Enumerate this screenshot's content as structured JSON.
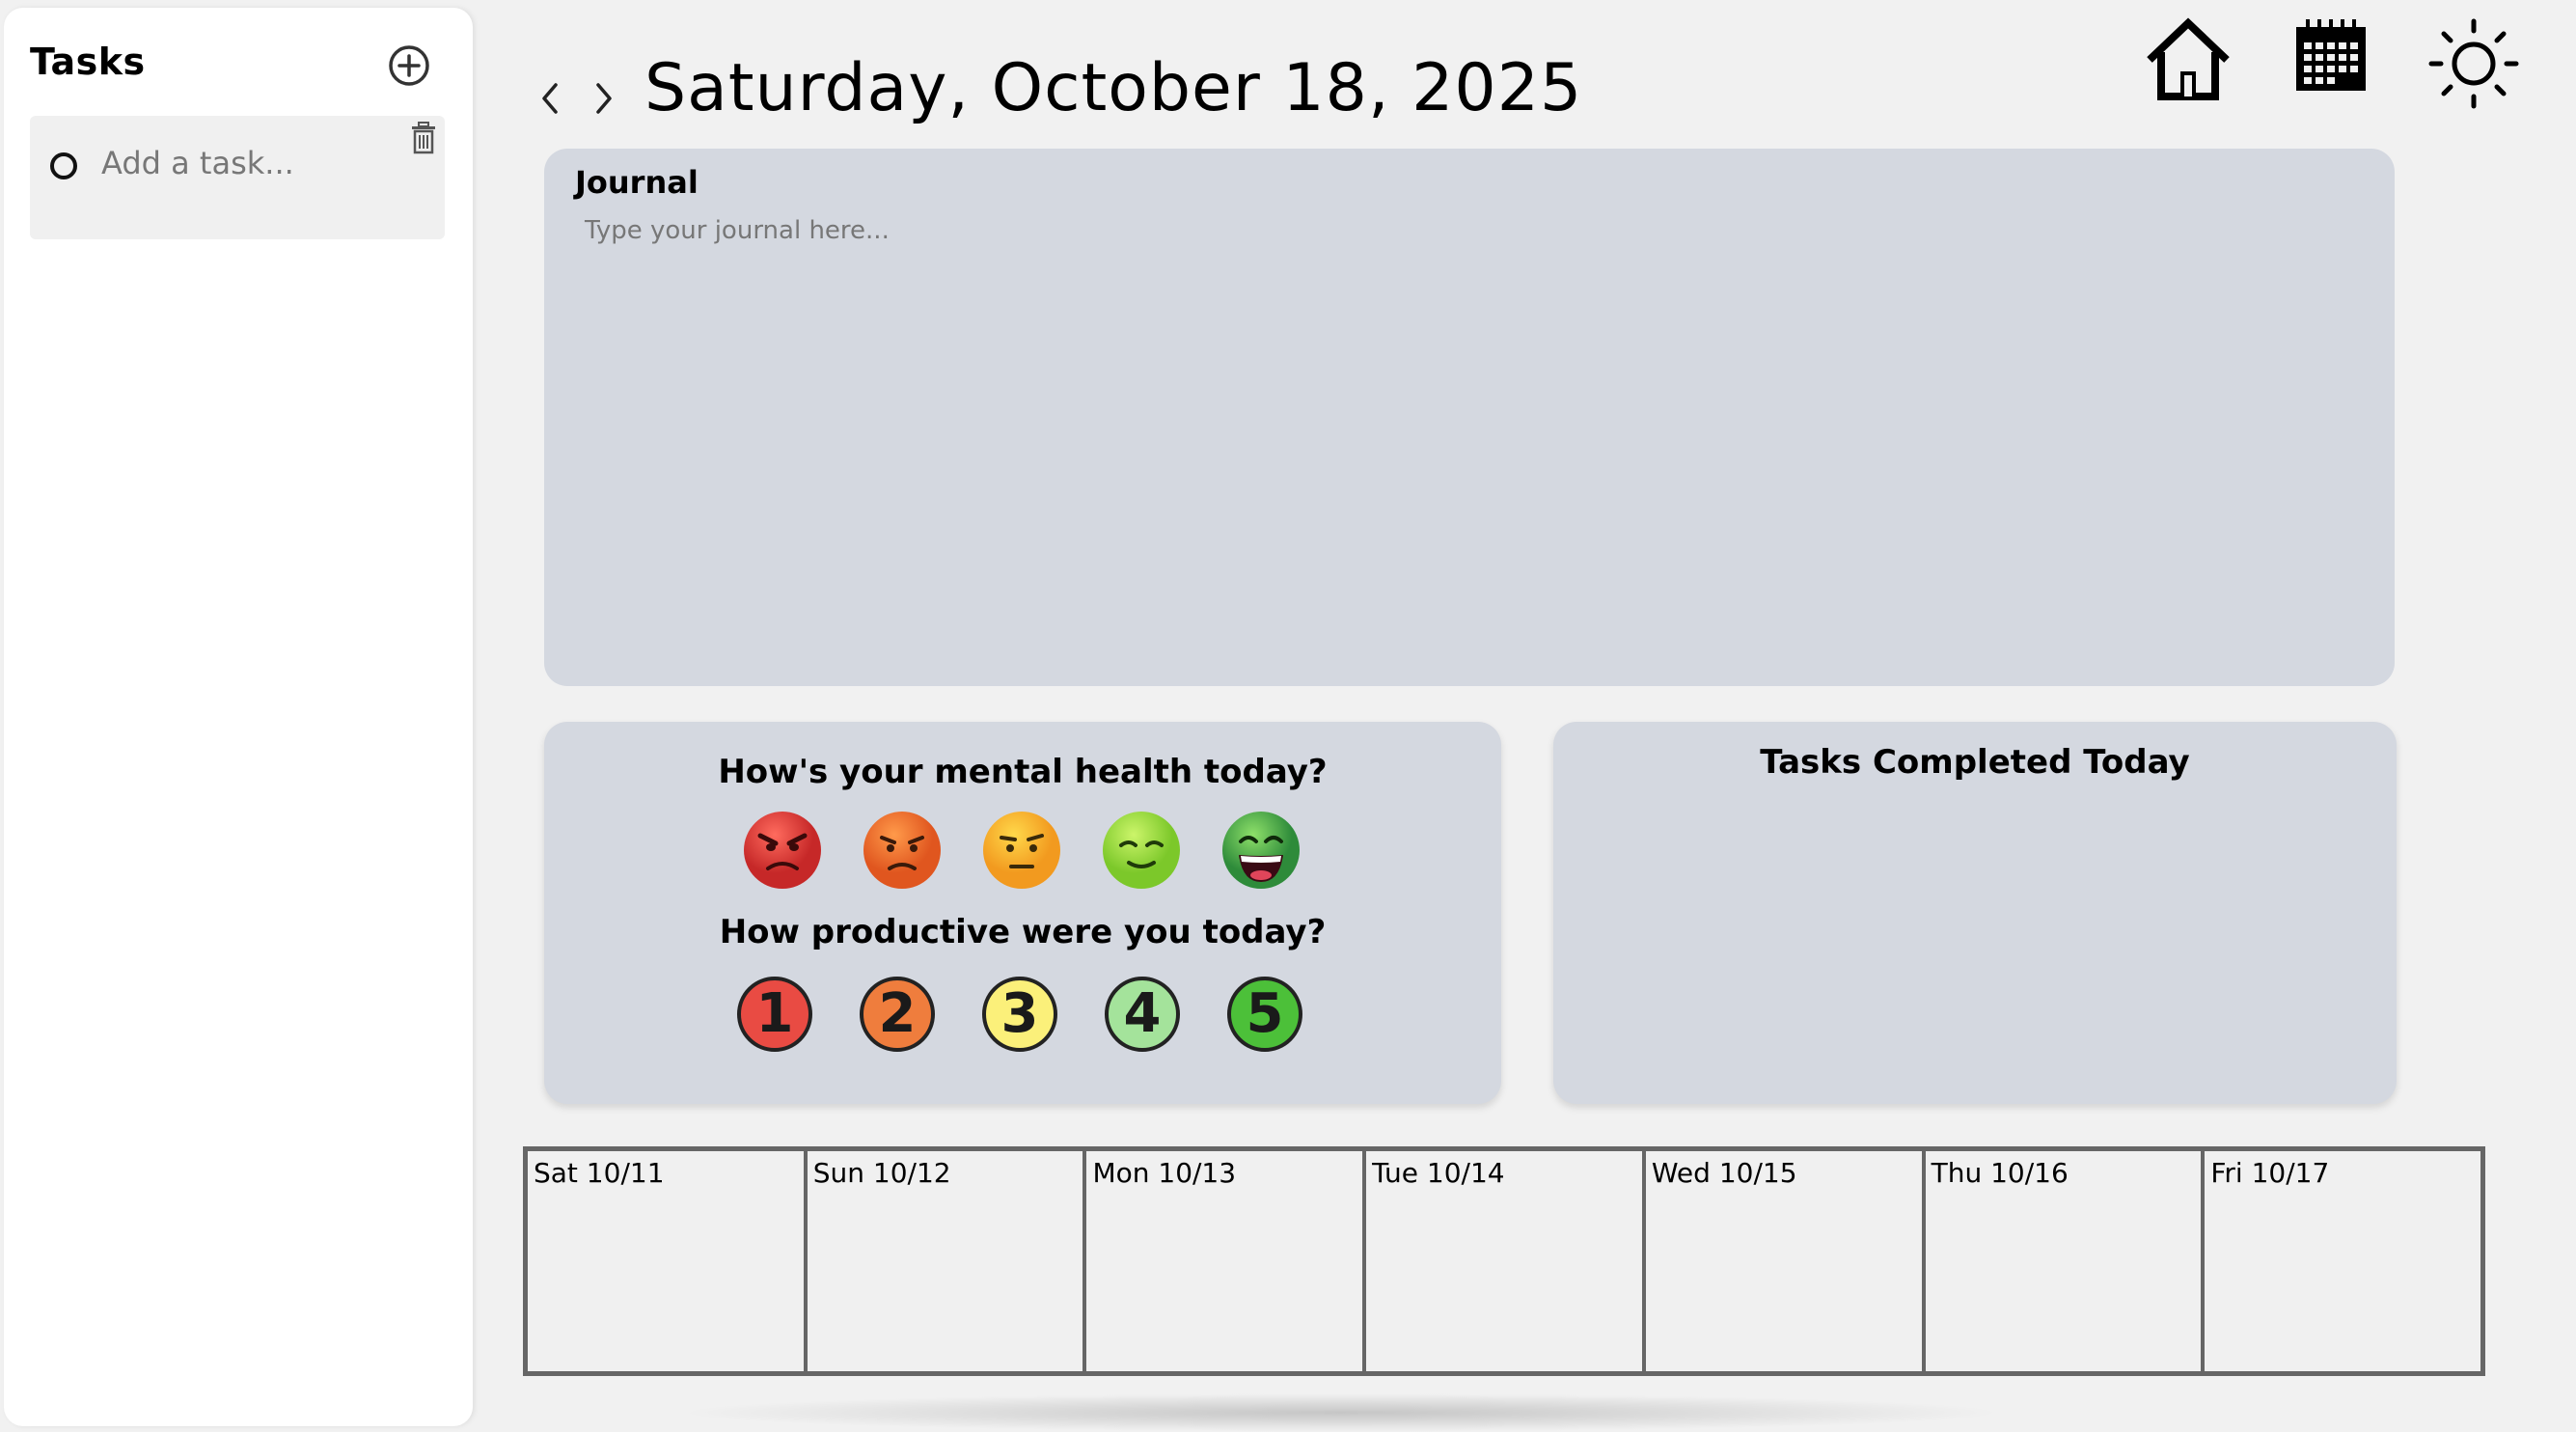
{
  "sidebar": {
    "title": "Tasks",
    "task_placeholder": "Add a task...",
    "icons": [
      "add-circle-icon",
      "trash-icon",
      "radio-circle-icon"
    ]
  },
  "header": {
    "date": "Saturday, October 18, 2025",
    "prev_icon": "chevron-left-icon",
    "next_icon": "chevron-right-icon",
    "icons": [
      "home-icon",
      "calendar-icon",
      "sun-icon"
    ]
  },
  "journal": {
    "title": "Journal",
    "placeholder": "Type your journal here..."
  },
  "mental_health": {
    "question": "How's your mental health today?",
    "options": [
      {
        "icon": "very-angry-face-icon",
        "color": "#e53935"
      },
      {
        "icon": "angry-face-icon",
        "color": "#f0652a"
      },
      {
        "icon": "neutral-face-icon",
        "color": "#f7b733"
      },
      {
        "icon": "content-face-icon",
        "color": "#9ee04a"
      },
      {
        "icon": "laughing-face-icon",
        "color": "#4caf50"
      }
    ]
  },
  "productivity": {
    "question": "How productive were you today?",
    "options": [
      {
        "label": "1",
        "color": "#e94b43"
      },
      {
        "label": "2",
        "color": "#ef7d3d"
      },
      {
        "label": "3",
        "color": "#fbf07a"
      },
      {
        "label": "4",
        "color": "#a4e39b"
      },
      {
        "label": "5",
        "color": "#4cc039"
      }
    ]
  },
  "completed": {
    "title": "Tasks Completed Today"
  },
  "week": {
    "days": [
      "Sat 10/11",
      "Sun 10/12",
      "Mon 10/13",
      "Tue 10/14",
      "Wed 10/15",
      "Thu 10/16",
      "Fri 10/17"
    ]
  }
}
